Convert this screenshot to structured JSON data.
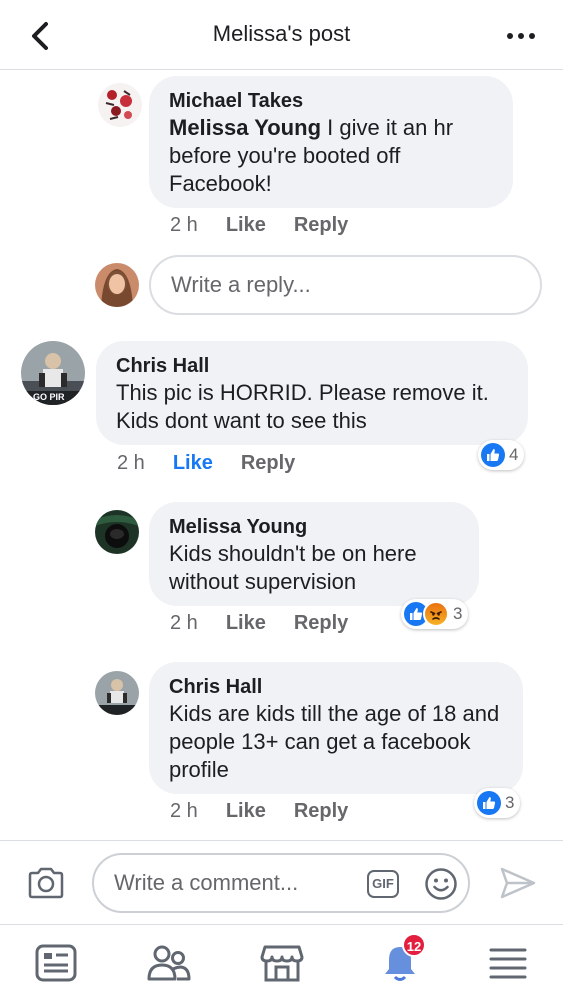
{
  "header": {
    "title": "Melissa's post"
  },
  "comments": [
    {
      "author": "Michael Takes",
      "mention": "Melissa Young",
      "text": " I give it an hr before you're booted off Facebook!",
      "time": "2 h",
      "like_label": "Like",
      "reply_label": "Reply"
    },
    {
      "author": "Chris Hall",
      "text": "This pic is HORRID. Please remove it. Kids dont want to see this",
      "time": "2 h",
      "like_label": "Like",
      "reply_label": "Reply",
      "liked": true,
      "reaction_count": "4",
      "avatar_caption": "GO PIR"
    },
    {
      "author": "Melissa Young",
      "text": "Kids shouldn't be on here without supervision",
      "time": "2 h",
      "like_label": "Like",
      "reply_label": "Reply",
      "reaction_count": "3"
    },
    {
      "author": "Chris Hall",
      "text": "Kids are kids till the age of 18 and people 13+ can get a facebook profile",
      "time": "2 h",
      "like_label": "Like",
      "reply_label": "Reply",
      "reaction_count": "3"
    }
  ],
  "reply_box": {
    "placeholder": "Write a reply..."
  },
  "composer": {
    "placeholder": "Write a comment...",
    "gif_label": "GIF"
  },
  "tabbar": {
    "notifications_badge": "12"
  },
  "colors": {
    "accent": "#1877f2",
    "bubble": "#f0f2f5",
    "muted": "#65676b",
    "badge": "#e41e3f"
  }
}
